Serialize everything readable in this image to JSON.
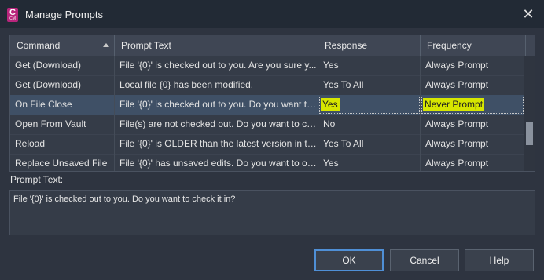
{
  "window": {
    "title": "Manage Prompts",
    "app_icon_letter": "C",
    "app_icon_sub": "CM"
  },
  "grid": {
    "columns": [
      "Command",
      "Prompt Text",
      "Response",
      "Frequency"
    ],
    "rows": [
      {
        "command": "Get (Download)",
        "prompt": "File '{0}' is checked out to you. Are you sure y...",
        "response": "Yes",
        "frequency": "Always Prompt"
      },
      {
        "command": "Get (Download)",
        "prompt": "Local file {0} has been modified.",
        "response": "Yes To All",
        "frequency": "Always Prompt"
      },
      {
        "command": "On File Close",
        "prompt": "File '{0}' is checked out to you. Do you want to...",
        "response": "Yes",
        "frequency": "Never Prompt"
      },
      {
        "command": "Open From Vault",
        "prompt": "File(s) are not checked out. Do you want to ch...",
        "response": "No",
        "frequency": "Always Prompt"
      },
      {
        "command": "Reload",
        "prompt": "File '{0}' is OLDER than the latest version in the...",
        "response": "Yes To All",
        "frequency": "Always Prompt"
      },
      {
        "command": "Replace Unsaved File",
        "prompt": "File '{0}' has unsaved edits. Do you want to ov...",
        "response": "Yes",
        "frequency": "Always Prompt"
      }
    ],
    "selected_row": 2
  },
  "prompt_text": {
    "label": "Prompt Text:",
    "value": "File '{0}' is checked out to you. Do you want to check it in?"
  },
  "buttons": {
    "ok": "OK",
    "cancel": "Cancel",
    "help": "Help"
  },
  "colors": {
    "highlight": "#d6e600",
    "selected_row": "#3f5066",
    "ok_border": "#4f8fd6"
  }
}
